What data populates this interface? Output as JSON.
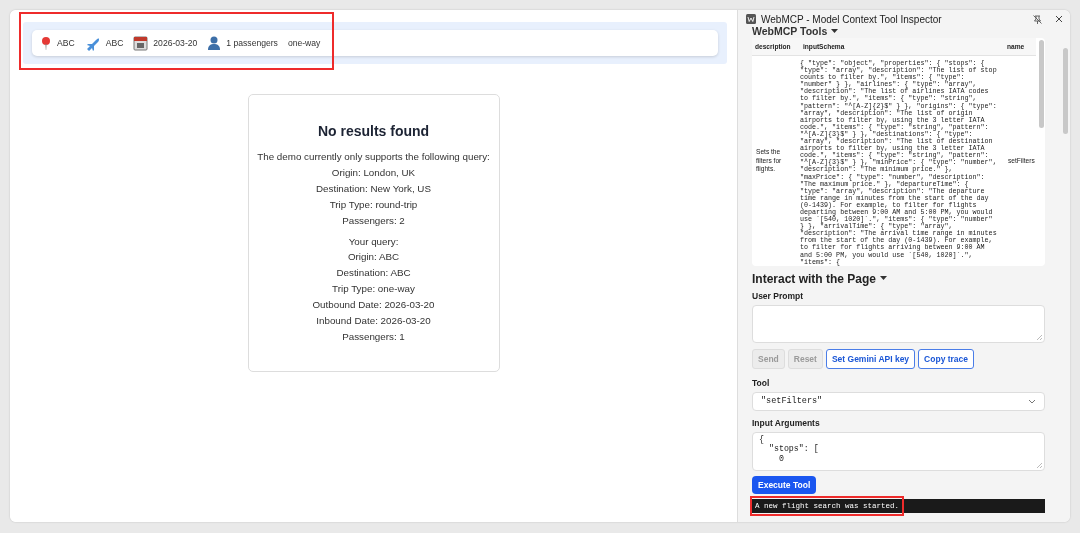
{
  "filter_bar": {
    "items": [
      {
        "kind": "origin",
        "label": "ABC"
      },
      {
        "kind": "flight",
        "label": "ABC"
      },
      {
        "kind": "date",
        "label": "2026-03-20"
      },
      {
        "kind": "passengers",
        "label": "1 passengers"
      },
      {
        "kind": "trip",
        "label": "one-way"
      }
    ]
  },
  "results": {
    "title": "No results found",
    "supported": [
      "The demo currently only supports the following query:",
      "Origin: London, UK",
      "Destination: New York, US",
      "Trip Type: round-trip",
      "Passengers: 2"
    ],
    "query": [
      "Your query:",
      "Origin: ABC",
      "Destination: ABC",
      "Trip Type: one-way",
      "Outbound Date: 2026-03-20",
      "Inbound Date: 2026-03-20",
      "Passengers: 1"
    ]
  },
  "inspector": {
    "title": "WebMCP - Model Context Tool Inspector",
    "tools_heading": "WebMCP Tools",
    "table": {
      "columns": [
        "description",
        "inputSchema",
        "name"
      ],
      "rows": [
        {
          "description": "Sets the filters for flights.",
          "inputSchema": "{ \"type\": \"object\", \"properties\": { \"stops\": { \"type\": \"array\", \"description\": \"The list of stop counts to filter by.\", \"items\": { \"type\": \"number\" } }, \"airlines\": { \"type\": \"array\", \"description\": \"The list of airlines IATA codes to filter by.\", \"items\": { \"type\": \"string\", \"pattern\": \"^[A-Z]{2}$\" } }, \"origins\": { \"type\": \"array\", \"description\": \"The list of origin airports to filter by, using the 3 letter IATA code.\", \"items\": { \"type\": \"string\", \"pattern\": \"^[A-Z]{3}$\" } }, \"destinations\": { \"type\": \"array\", \"description\": \"The list of destination airports to filter by, using the 3 letter IATA code.\", \"items\": { \"type\": \"string\", \"pattern\": \"^[A-Z]{3}$\" } }, \"minPrice\": { \"type\": \"number\", \"description\": \"The minimum price.\" }, \"maxPrice\": { \"type\": \"number\", \"description\": \"The maximum price.\" }, \"departureTime\": { \"type\": \"array\", \"description\": \"The departure time range in minutes from the start of the day (0-1439). For example, to filter for flights departing between 9:00 AM and 5:00 PM, you would use `[540, 1020]`.\", \"items\": { \"type\": \"number\" } }, \"arrivalTime\": { \"type\": \"array\", \"description\": \"The arrival time range in minutes from the start of the day (0-1439). For example, to filter for flights arriving between 9:00 AM and 5:00 PM, you would use `[540, 1020]`.\", \"items\": {",
          "name": "setFilters"
        }
      ]
    },
    "interact_heading": "Interact with the Page",
    "prompt_label": "User Prompt",
    "buttons": [
      {
        "label": "Send",
        "disabled": true
      },
      {
        "label": "Reset",
        "disabled": true
      },
      {
        "label": "Set Gemini API key",
        "disabled": false
      },
      {
        "label": "Copy trace",
        "disabled": false
      }
    ],
    "tool_label": "Tool",
    "tool_value": "\"setFilters\"",
    "args_label": "Input Arguments",
    "args_value": "{\n  \"stops\": [\n    0",
    "execute": "Execute Tool",
    "output": "A new flight search was started."
  }
}
